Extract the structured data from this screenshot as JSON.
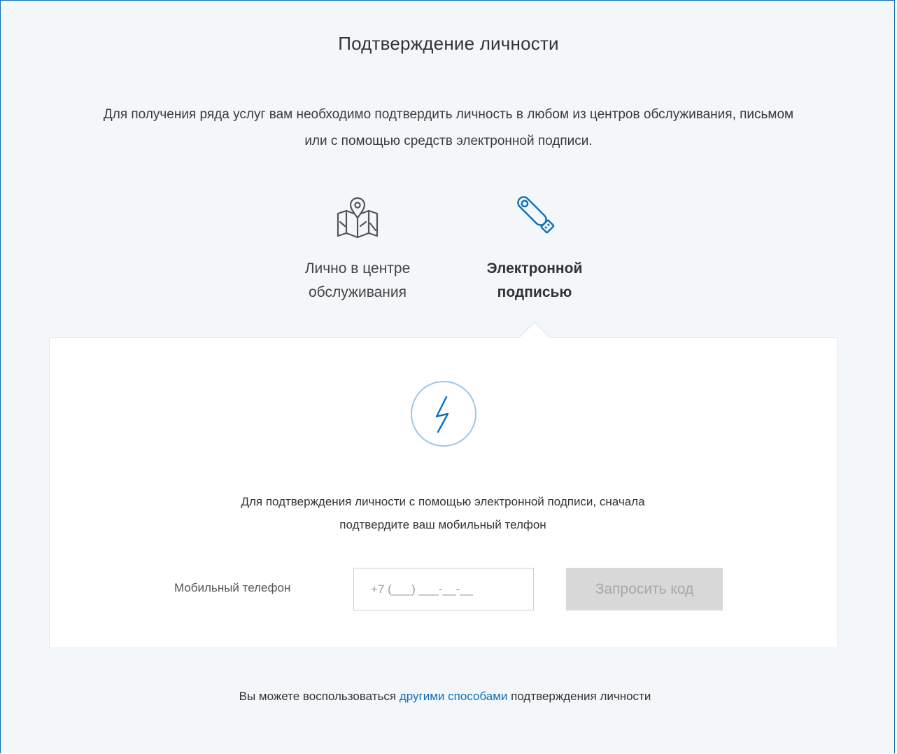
{
  "page": {
    "title": "Подтверждение личности",
    "intro": "Для получения ряда услуг вам необходимо подтвердить личность в любом из центров обслуживания, письмом или с помощью средств электронной подписи."
  },
  "methods": [
    {
      "icon": "map-pin-icon",
      "label_line1": "Лично в центре",
      "label_line2": "обслуживания",
      "selected": false
    },
    {
      "icon": "usb-token-icon",
      "label_line1": "Электронной",
      "label_line2": "подписью",
      "selected": true
    }
  ],
  "panel": {
    "icon": "lightning-icon",
    "text_line1": "Для подтверждения личности с помощью электронной подписи, сначала",
    "text_line2": "подтвердите ваш мобильный телфон",
    "phone_label": "Мобильный телефон",
    "phone_placeholder": "+7 (___) ___-__-__",
    "phone_value": "",
    "request_button": "Запросить код",
    "request_button_disabled": true
  },
  "footer": {
    "text_before": "Вы можете воспользоваться ",
    "link_text": "другими способами",
    "text_after": " подтверждения личности"
  },
  "colors": {
    "accent": "#0d6fb8",
    "page_background": "#f4f7fa",
    "panel_background": "#ffffff",
    "disabled_button": "#d8d8d8",
    "icon_gray": "#555555"
  }
}
